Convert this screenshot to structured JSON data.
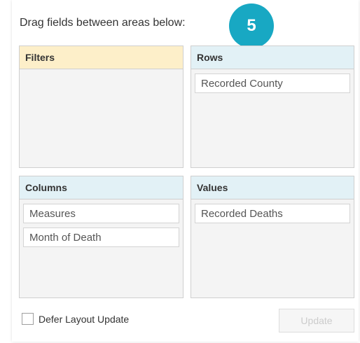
{
  "header": {
    "instruction": "Drag fields between areas below:"
  },
  "step_badge": {
    "number": "5",
    "color": "#18a8c3"
  },
  "areas": {
    "filters": {
      "title": "Filters",
      "fields": []
    },
    "rows": {
      "title": "Rows",
      "fields": [
        "Recorded County"
      ]
    },
    "columns": {
      "title": "Columns",
      "fields": [
        "Measures",
        "Month of Death"
      ]
    },
    "values": {
      "title": "Values",
      "fields": [
        "Recorded Deaths"
      ]
    }
  },
  "footer": {
    "defer_label": "Defer Layout Update",
    "defer_checked": false,
    "update_label": "Update"
  },
  "colors": {
    "filters_header": "#fdefc9",
    "other_headers": "#e2f1f6",
    "area_background": "#f4f4f4"
  }
}
